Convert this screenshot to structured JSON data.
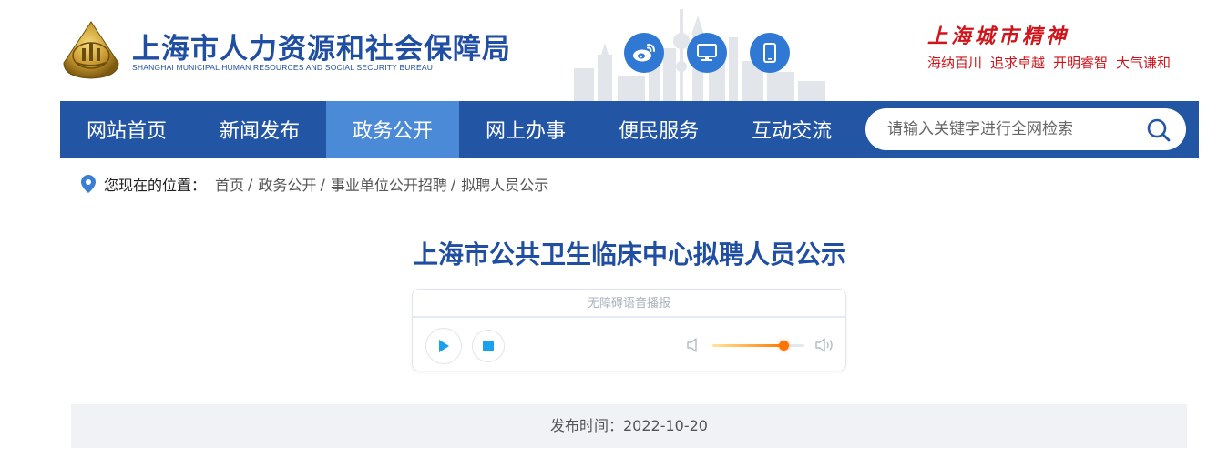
{
  "header": {
    "title": "上海市人力资源和社会保障局",
    "subtitle": "SHANGHAI MUNICIPAL HUMAN RESOURCES AND SOCIAL SECURITY BUREAU",
    "social": [
      {
        "name": "weibo-icon"
      },
      {
        "name": "desktop-icon"
      },
      {
        "name": "mobile-icon"
      }
    ],
    "spirit_title": "上海城市精神",
    "spirit_items": [
      "海纳百川",
      "追求卓越",
      "开明睿智",
      "大气谦和"
    ]
  },
  "nav": {
    "items": [
      {
        "label": "网站首页",
        "active": false
      },
      {
        "label": "新闻发布",
        "active": false
      },
      {
        "label": "政务公开",
        "active": true
      },
      {
        "label": "网上办事",
        "active": false
      },
      {
        "label": "便民服务",
        "active": false
      },
      {
        "label": "互动交流",
        "active": false
      }
    ],
    "search_placeholder": "请输入关键字进行全网检索"
  },
  "breadcrumb": {
    "label": "您现在的位置：",
    "items": [
      "首页",
      "政务公开",
      "事业单位公开招聘",
      "拟聘人员公示"
    ]
  },
  "article": {
    "title": "上海市公共卫生临床中心拟聘人员公示",
    "player": {
      "header": "无障碍语音播报",
      "volume": 0.77
    },
    "publish_label": "发布时间：2022-10-20"
  },
  "colors": {
    "brand_blue": "#2255a4",
    "nav_active": "#4a8ad6",
    "accent_red": "#d0141b",
    "player_blue": "#1aa0f0",
    "volume_orange": "#ff7300"
  }
}
